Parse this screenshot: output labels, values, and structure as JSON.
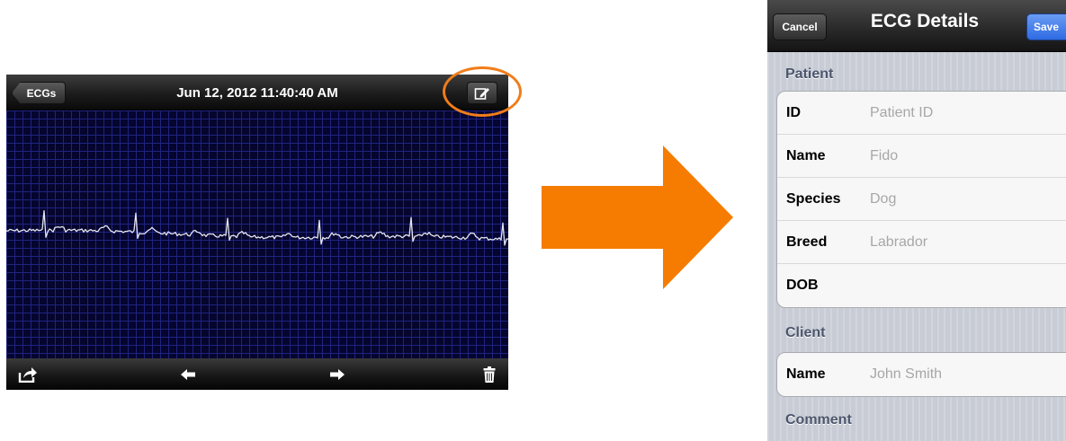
{
  "ecg_viewer": {
    "back_label": "ECGs",
    "title": "Jun 12, 2012 11:40:40 AM",
    "edit_icon": "compose-icon",
    "toolbar": {
      "share_icon": "share-icon",
      "prev_icon": "arrow-left-icon",
      "next_icon": "arrow-right-icon",
      "trash_icon": "trash-icon"
    },
    "colors": {
      "grid_background": "#05052e",
      "grid_lines": "#1f2480",
      "trace": "#e6e6f0",
      "highlight": "#f07d1a"
    }
  },
  "arrow": {
    "color": "#f57c00"
  },
  "details": {
    "cancel_label": "Cancel",
    "title": "ECG Details",
    "save_label": "Save",
    "sections": {
      "patient": {
        "header": "Patient",
        "rows": [
          {
            "label": "ID",
            "placeholder": "Patient ID"
          },
          {
            "label": "Name",
            "placeholder": "Fido"
          },
          {
            "label": "Species",
            "placeholder": "Dog"
          },
          {
            "label": "Breed",
            "placeholder": "Labrador"
          },
          {
            "label": "DOB",
            "placeholder": ""
          }
        ]
      },
      "client": {
        "header": "Client",
        "rows": [
          {
            "label": "Name",
            "placeholder": "John Smith"
          }
        ]
      },
      "comment": {
        "header": "Comment"
      }
    },
    "colors": {
      "save_button": "#2e6be3",
      "section_header": "#4c566c",
      "placeholder_text": "#a7a7a7"
    }
  }
}
